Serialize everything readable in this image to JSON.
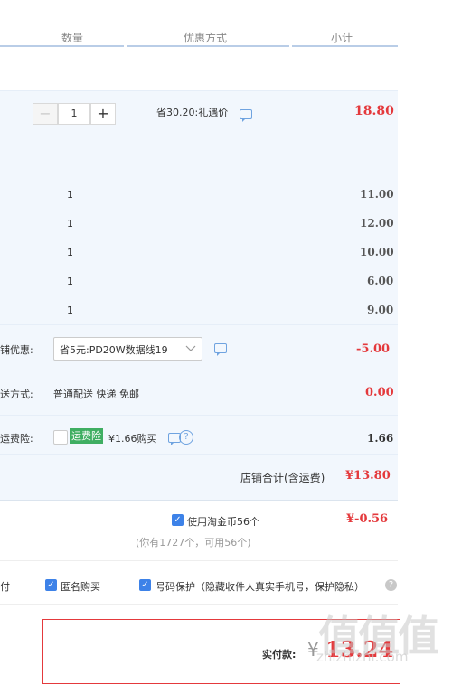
{
  "header": {
    "qty": "数量",
    "discount": "优惠方式",
    "subtotal": "小计"
  },
  "main_item": {
    "quantity": "1",
    "minus": "−",
    "plus": "+",
    "discount_text": "省30.20:礼遇价",
    "subtotal": "18.80"
  },
  "sub_items": [
    {
      "qty": "1",
      "price": "11.00"
    },
    {
      "qty": "1",
      "price": "12.00"
    },
    {
      "qty": "1",
      "price": "10.00"
    },
    {
      "qty": "1",
      "price": "6.00"
    },
    {
      "qty": "1",
      "price": "9.00"
    }
  ],
  "shop_discount": {
    "label": "铺优惠:",
    "selected": "省5元:PD20W数据线19",
    "amount": "-5.00"
  },
  "shipping": {
    "label": "送方式:",
    "value": "普通配送 快递 免邮",
    "amount": "0.00"
  },
  "insurance": {
    "label": "运费险:",
    "tag": "运费险",
    "text": "¥1.66购买",
    "amount": "1.66"
  },
  "shop_total": {
    "label": "店铺合计(含运费)",
    "amount": "¥13.80"
  },
  "coins": {
    "label": "使用淘金币56个",
    "note": "(你有1727个，可用56个)",
    "amount": "¥-0.56"
  },
  "options": {
    "pay_fragment": "付",
    "anonymous": "匿名购买",
    "privacy": "号码保护（隐藏收件人真实手机号，保护隐私）"
  },
  "payment": {
    "label": "实付款:",
    "currency": "¥",
    "amount": "13.24"
  },
  "watermark": {
    "logo": "值值值",
    "url": "zhizhizhi.com"
  },
  "colors": {
    "price_red": "#e4393c",
    "band_blue": "#f2f7fd",
    "checkbox_blue": "#3d82e8",
    "insurance_green": "#3fae62"
  },
  "icons": [
    "chat-icon",
    "help-icon",
    "question-icon",
    "chevron-down-icon",
    "check-icon"
  ]
}
